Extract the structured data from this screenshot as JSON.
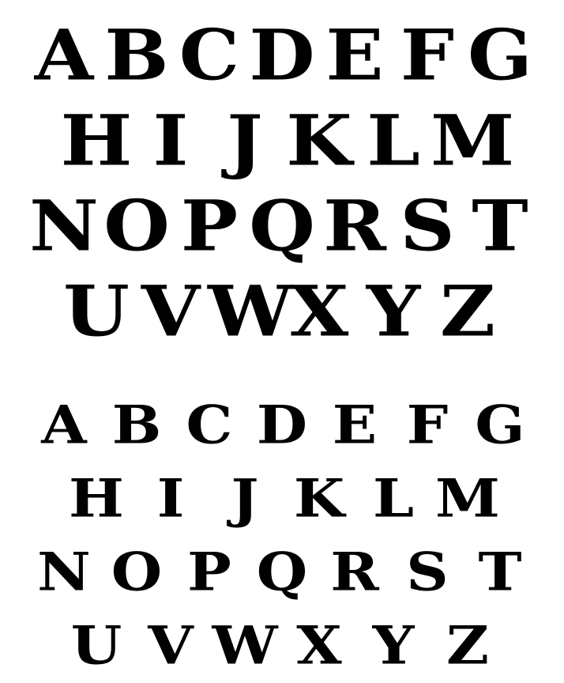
{
  "specimen": {
    "large": {
      "rows": [
        [
          "A",
          "B",
          "C",
          "D",
          "E",
          "F",
          "G"
        ],
        [
          "H",
          "I",
          "J",
          "K",
          "L",
          "M"
        ],
        [
          "N",
          "O",
          "P",
          "Q",
          "R",
          "S",
          "T"
        ],
        [
          "U",
          "V",
          "W",
          "X",
          "Y",
          "Z"
        ]
      ]
    },
    "small": {
      "rows": [
        [
          "A",
          "B",
          "C",
          "D",
          "E",
          "F",
          "G"
        ],
        [
          "H",
          "I",
          "J",
          "K",
          "L",
          "M"
        ],
        [
          "N",
          "O",
          "P",
          "Q",
          "R",
          "S",
          "T"
        ],
        [
          "U",
          "V",
          "W",
          "X",
          "Y",
          "Z"
        ]
      ]
    },
    "ink_color": "#000000",
    "paper_color": "#ffffff"
  }
}
